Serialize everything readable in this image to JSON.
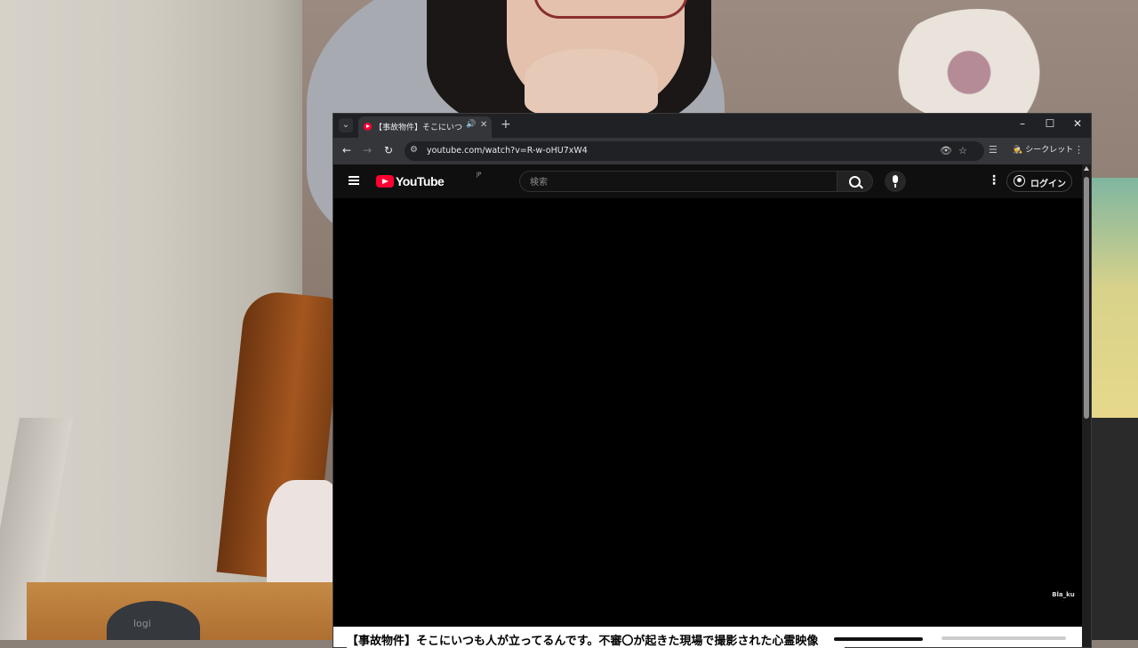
{
  "browser": {
    "tab": {
      "title": "【事故物件】そこにいつも人が立ってるんです。不審〇が起きた現場で撮影された心霊映像",
      "audio_icon": "speaker-icon",
      "close_glyph": "✕"
    },
    "tab_list_glyph": "⌄",
    "new_tab_glyph": "+",
    "window_controls": {
      "minimize": "–",
      "maximize": "☐",
      "close": "✕"
    },
    "nav": {
      "back": "←",
      "forward": "→",
      "reload": "↻"
    },
    "address": "youtube.com/watch?v=R-w-oHU7xW4",
    "omnibox_icons": {
      "tracking": "👁",
      "bookmark": "☆"
    },
    "toolbar_icons": {
      "reading_list": "☰",
      "menu": "⋮"
    },
    "incognito_label": "シークレット",
    "incognito_glyph": "🕵"
  },
  "youtube": {
    "logo_text": "YouTube",
    "logo_region": "JP",
    "search_placeholder": "検索",
    "login_label": "ログイン",
    "more_glyph": "⋮",
    "video_title": "【事故物件】そこにいつも人が立ってるんです。不審〇が起きた現場で撮影された心霊映像",
    "watermark": "Bla_ku",
    "colors": {
      "brand_red": "#ff0033",
      "link_blue": "#3ea6ff",
      "page_bg": "#0f0f0f"
    }
  }
}
